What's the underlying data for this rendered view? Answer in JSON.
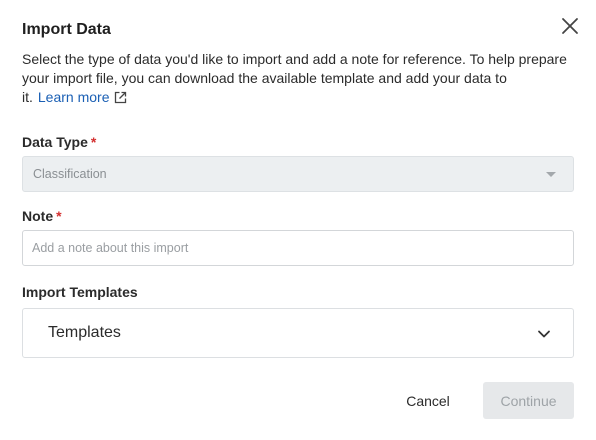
{
  "dialog": {
    "title": "Import Data",
    "description": "Select the type of data you'd like to import and add a note for reference. To help prepare your import file, you can download the available template and add your data to it.",
    "learn_more": "Learn more",
    "close_icon": "close-icon",
    "external_link_icon": "external-link-icon"
  },
  "data_type": {
    "label": "Data Type",
    "required_mark": "*",
    "selected_value": "Classification",
    "disabled": true
  },
  "note": {
    "label": "Note",
    "required_mark": "*",
    "value": "",
    "placeholder": "Add a note about this import"
  },
  "import_templates": {
    "label": "Import Templates",
    "dropdown_label": "Templates",
    "icon": "chevron-down-icon"
  },
  "actions": {
    "cancel_label": "Cancel",
    "continue_label": "Continue",
    "continue_disabled": true
  },
  "colors": {
    "link": "#1a5fb4",
    "required": "#d32f2f",
    "disabled_bg": "#eceff1"
  }
}
